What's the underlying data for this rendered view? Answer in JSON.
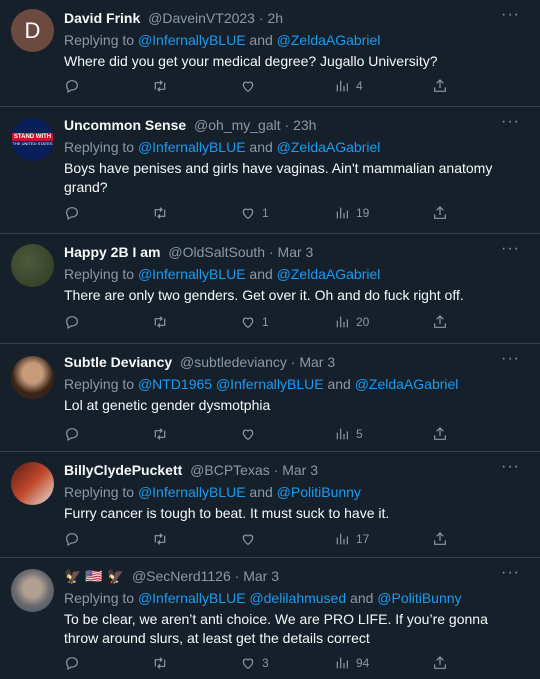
{
  "tweets": [
    {
      "name": "David Frink",
      "handle": "@DaveinVT2023",
      "time": "2h",
      "replying_prefix": "Replying to ",
      "replying_to": [
        "@InfernallyBLUE",
        "@ZeldaAGabriel"
      ],
      "text": "Where did you get your medical degree? Jugallo University?",
      "likes": "",
      "views": "4",
      "avatar_letter": "D"
    },
    {
      "name": "Uncommon Sense",
      "handle": "@oh_my_galt",
      "time": "23h",
      "replying_prefix": "Replying to ",
      "replying_to": [
        "@InfernallyBLUE",
        "@ZeldaAGabriel"
      ],
      "text": "Boys have penises and girls have vaginas. Ain't mammalian anatomy grand?",
      "likes": "1",
      "views": "19",
      "avatar_text_1": "STAND WITH",
      "avatar_text_2": "THE UNITED STATES"
    },
    {
      "name": "Happy 2B I am",
      "handle": "@OldSaltSouth",
      "time": "Mar 3",
      "replying_prefix": "Replying to ",
      "replying_to": [
        "@InfernallyBLUE",
        "@ZeldaAGabriel"
      ],
      "text": "There are only two genders. Get over it. Oh and do fuck right off.",
      "likes": "1",
      "views": "20"
    },
    {
      "name": "Subtle Deviancy",
      "handle": "@subtledeviancy",
      "time": "Mar 3",
      "replying_prefix": "Replying to ",
      "replying_to": [
        "@NTD1965",
        "@InfernallyBLUE",
        "@ZeldaAGabriel"
      ],
      "text": "Lol at genetic gender dysmotphia",
      "likes": "",
      "views": "5"
    },
    {
      "name": "BillyClydePuckett",
      "handle": "@BCPTexas",
      "time": "Mar 3",
      "replying_prefix": "Replying to ",
      "replying_to": [
        "@InfernallyBLUE",
        "@PolitiBunny"
      ],
      "text": "Furry cancer is tough to beat. It must suck to have it.",
      "likes": "",
      "views": "17"
    },
    {
      "name": "🦅 🇺🇸 🦅",
      "handle": "@SecNerd1126",
      "time": "Mar 3",
      "replying_prefix": "Replying to ",
      "replying_to": [
        "@InfernallyBLUE",
        "@delilahmused",
        "@PolitiBunny"
      ],
      "text": "To be clear, we aren’t anti choice. We are PRO LIFE. If you’re gonna throw around slurs, at least get the details correct",
      "likes": "3",
      "views": "94"
    }
  ],
  "common": {
    "dot": "·",
    "and": " and ",
    "more": "···"
  },
  "icons": [
    "reply-icon",
    "retweet-icon",
    "like-icon",
    "views-icon",
    "share-icon",
    "more-icon"
  ]
}
